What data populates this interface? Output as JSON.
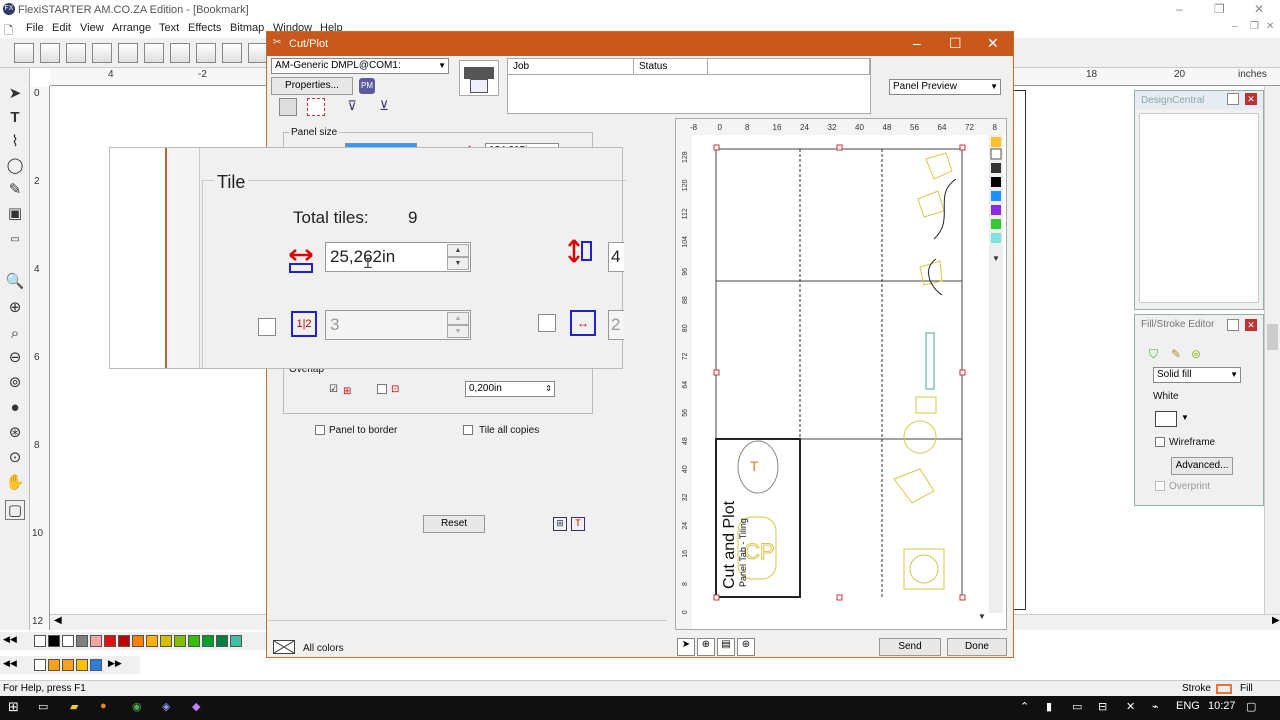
{
  "app": {
    "title": "FlexiSTARTER AM.CO.ZA Edition - [Bookmark]",
    "icon_label": "FX",
    "menu": [
      "File",
      "Edit",
      "View",
      "Arrange",
      "Text",
      "Effects",
      "Bitmap",
      "Window",
      "Help"
    ],
    "status": "For Help, press F1",
    "stroke_label": "Stroke",
    "fill_label": "Fill",
    "units_label": "inches"
  },
  "ruler": {
    "h_labels": [
      "4",
      "-2",
      "18",
      "20"
    ],
    "v_labels": [
      "0",
      "2",
      "4",
      "6",
      "8",
      "10",
      "12"
    ]
  },
  "dialog": {
    "title": "Cut/Plot",
    "device": "AM-Generic DMPL@COM1:",
    "properties_label": "Properties...",
    "job_header": "Job",
    "status_header": "Status",
    "preview_mode": "Panel Preview",
    "panel_size_label": "Panel size",
    "panel_width_value": "25,262in",
    "panel_height_value": "124,015in",
    "overlap_label": "Overlap",
    "overlap_value": "0,200in",
    "panel_to_border": "Panel to border",
    "tile_all_copies": "Tile all copies",
    "reset_label": "Reset",
    "all_colors_label": "All colors",
    "send_label": "Send",
    "done_label": "Done",
    "preview_ruler_top": [
      "-8",
      "0",
      "8",
      "16",
      "24",
      "32",
      "40",
      "48",
      "56",
      "64",
      "72",
      "8"
    ],
    "preview_ruler_left": [
      "128",
      "120",
      "112",
      "104",
      "96",
      "88",
      "80",
      "72",
      "64",
      "56",
      "48",
      "40",
      "32",
      "24",
      "16",
      "8",
      "0"
    ],
    "preview_text_main": "Cut and Plot",
    "preview_text_sub": "Panel Tab - Tiling"
  },
  "tile": {
    "group_label": "Tile",
    "total_label": "Total tiles:",
    "total_value": "9",
    "width_value": "25,262in",
    "columns_value": "3",
    "right_partial_a": "4",
    "right_partial_b": "2"
  },
  "design_central": {
    "title": "DesignCentral"
  },
  "fill_stroke": {
    "title": "Fill/Stroke Editor",
    "fill_type": "Solid fill",
    "color_name": "White",
    "wireframe": "Wireframe",
    "advanced": "Advanced...",
    "overprint": "Overprint"
  },
  "taskbar": {
    "lang": "ENG",
    "time": "10:27"
  },
  "colors": {
    "accent": "#c8581c",
    "palette": [
      "#000000",
      "#ffffff",
      "#7f7f7f",
      "#f4a6a6",
      "#e01010",
      "#c00000",
      "#ff7f00",
      "#ffb000",
      "#d4c000",
      "#80c000",
      "#30c000",
      "#00a030",
      "#008040",
      "#40c0a0"
    ]
  }
}
